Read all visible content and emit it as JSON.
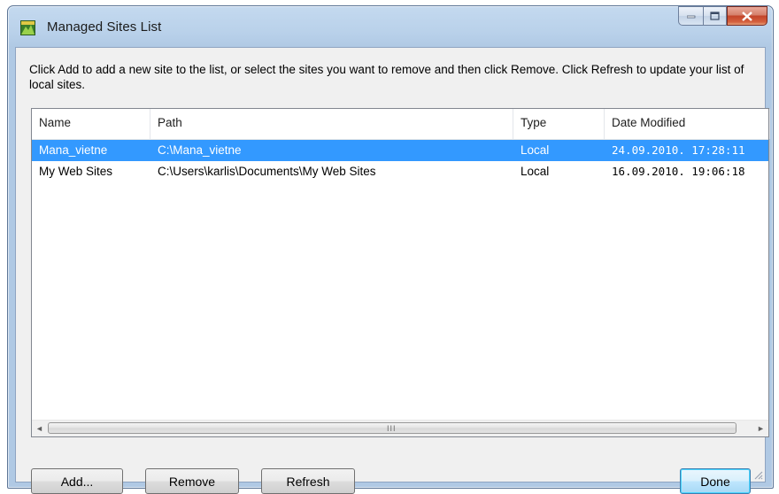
{
  "window": {
    "title": "Managed Sites List",
    "caption": {
      "minimize_icon": "minimize-icon",
      "maximize_icon": "maximize-icon",
      "close_icon": "close-icon"
    }
  },
  "instructions": "Click Add to add a new site to the list, or select the sites you want to remove and then click Remove.  Click Refresh to update your list of local sites.",
  "list": {
    "columns": [
      "Name",
      "Path",
      "Type",
      "Date Modified"
    ],
    "rows": [
      {
        "name": "Mana_vietne",
        "path": "C:\\Mana_vietne",
        "type": "Local",
        "date": "24.09.2010. 17:28:11",
        "selected": true
      },
      {
        "name": "My Web Sites",
        "path": "C:\\Users\\karlis\\Documents\\My Web Sites",
        "type": "Local",
        "date": "16.09.2010. 19:06:18",
        "selected": false
      }
    ],
    "selection_color": "#3399ff"
  },
  "scrollbar": {
    "left_arrow": "◄",
    "right_arrow": "►",
    "grip": "III"
  },
  "buttons": {
    "add": "Add...",
    "remove": "Remove",
    "refresh": "Refresh",
    "done": "Done"
  }
}
